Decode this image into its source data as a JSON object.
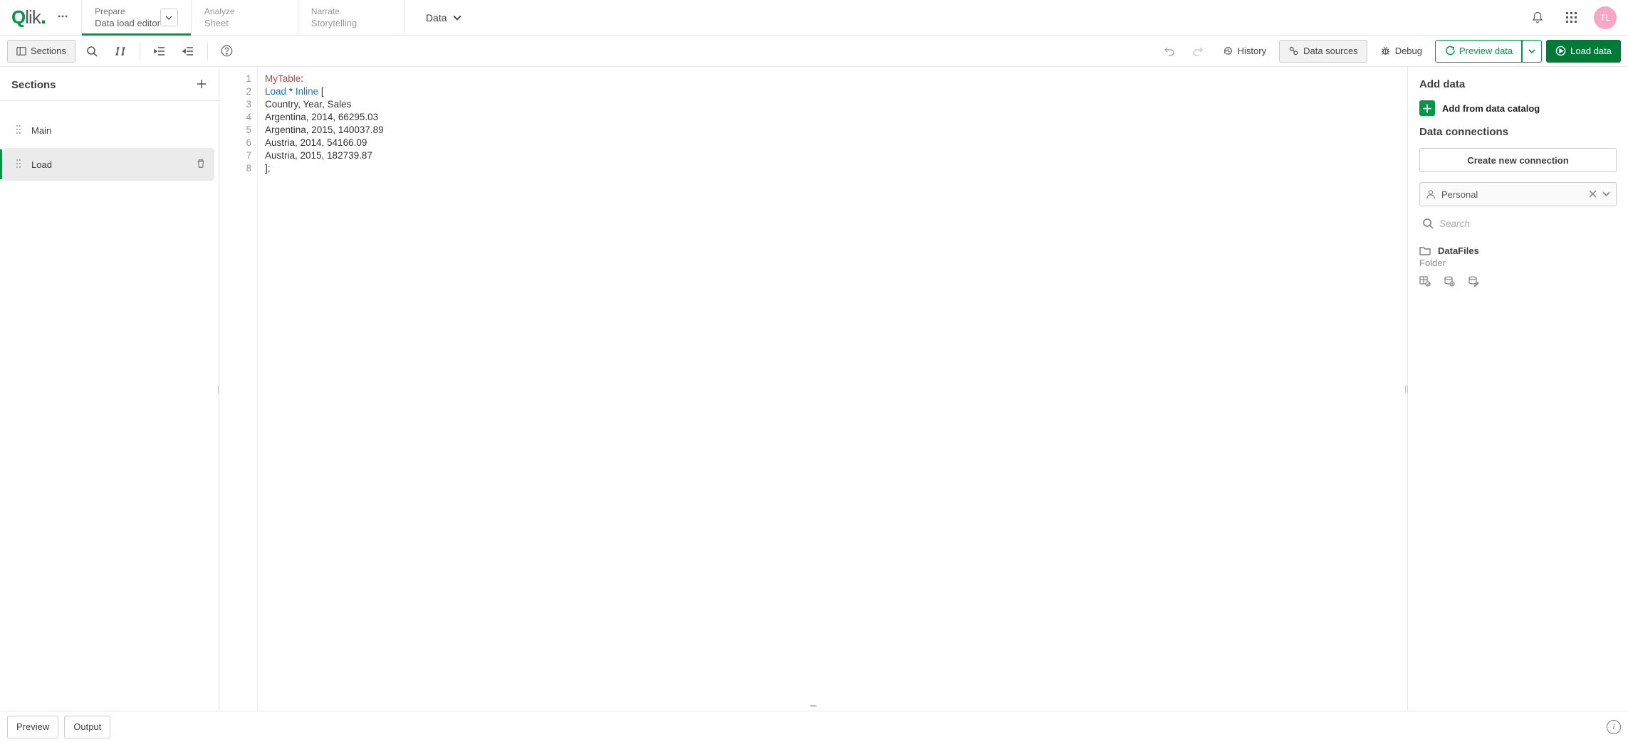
{
  "nav": {
    "prepare": {
      "small": "Prepare",
      "big": "Data load editor"
    },
    "analyze": {
      "small": "Analyze",
      "big": "Sheet"
    },
    "narrate": {
      "small": "Narrate",
      "big": "Storytelling"
    },
    "dataDropdown": "Data"
  },
  "avatarInitials": "TL",
  "toolbar": {
    "sections": "Sections",
    "history": "History",
    "dataSources": "Data sources",
    "debug": "Debug",
    "previewData": "Preview data",
    "loadData": "Load data"
  },
  "sidebar": {
    "title": "Sections",
    "items": [
      {
        "label": "Main"
      },
      {
        "label": "Load"
      }
    ],
    "activeIndex": 1
  },
  "editor": {
    "lines": [
      {
        "n": 1,
        "segs": [
          {
            "t": "MyTable",
            "c": "tok-name"
          },
          {
            "t": ":",
            "c": "tok-text"
          }
        ]
      },
      {
        "n": 2,
        "segs": [
          {
            "t": "Load",
            "c": "tok-keyword"
          },
          {
            "t": " * ",
            "c": "tok-text"
          },
          {
            "t": "Inline",
            "c": "tok-keyword"
          },
          {
            "t": " [",
            "c": "tok-text"
          }
        ]
      },
      {
        "n": 3,
        "segs": [
          {
            "t": "Country, Year, Sales",
            "c": "tok-text"
          }
        ]
      },
      {
        "n": 4,
        "segs": [
          {
            "t": "Argentina, 2014, 66295.03",
            "c": "tok-text"
          }
        ]
      },
      {
        "n": 5,
        "segs": [
          {
            "t": "Argentina, 2015, 140037.89",
            "c": "tok-text"
          }
        ]
      },
      {
        "n": 6,
        "segs": [
          {
            "t": "Austria, 2014, 54166.09",
            "c": "tok-text"
          }
        ]
      },
      {
        "n": 7,
        "segs": [
          {
            "t": "Austria, 2015, 182739.87",
            "c": "tok-text"
          }
        ]
      },
      {
        "n": 8,
        "segs": [
          {
            "t": "];",
            "c": "tok-text"
          }
        ]
      }
    ]
  },
  "right": {
    "addDataTitle": "Add data",
    "addFromCatalog": "Add from data catalog",
    "connectionsTitle": "Data connections",
    "createConn": "Create new connection",
    "space": "Personal",
    "searchPlaceholder": "Search",
    "folderName": "DataFiles",
    "folderType": "Folder"
  },
  "bottom": {
    "preview": "Preview",
    "output": "Output"
  }
}
